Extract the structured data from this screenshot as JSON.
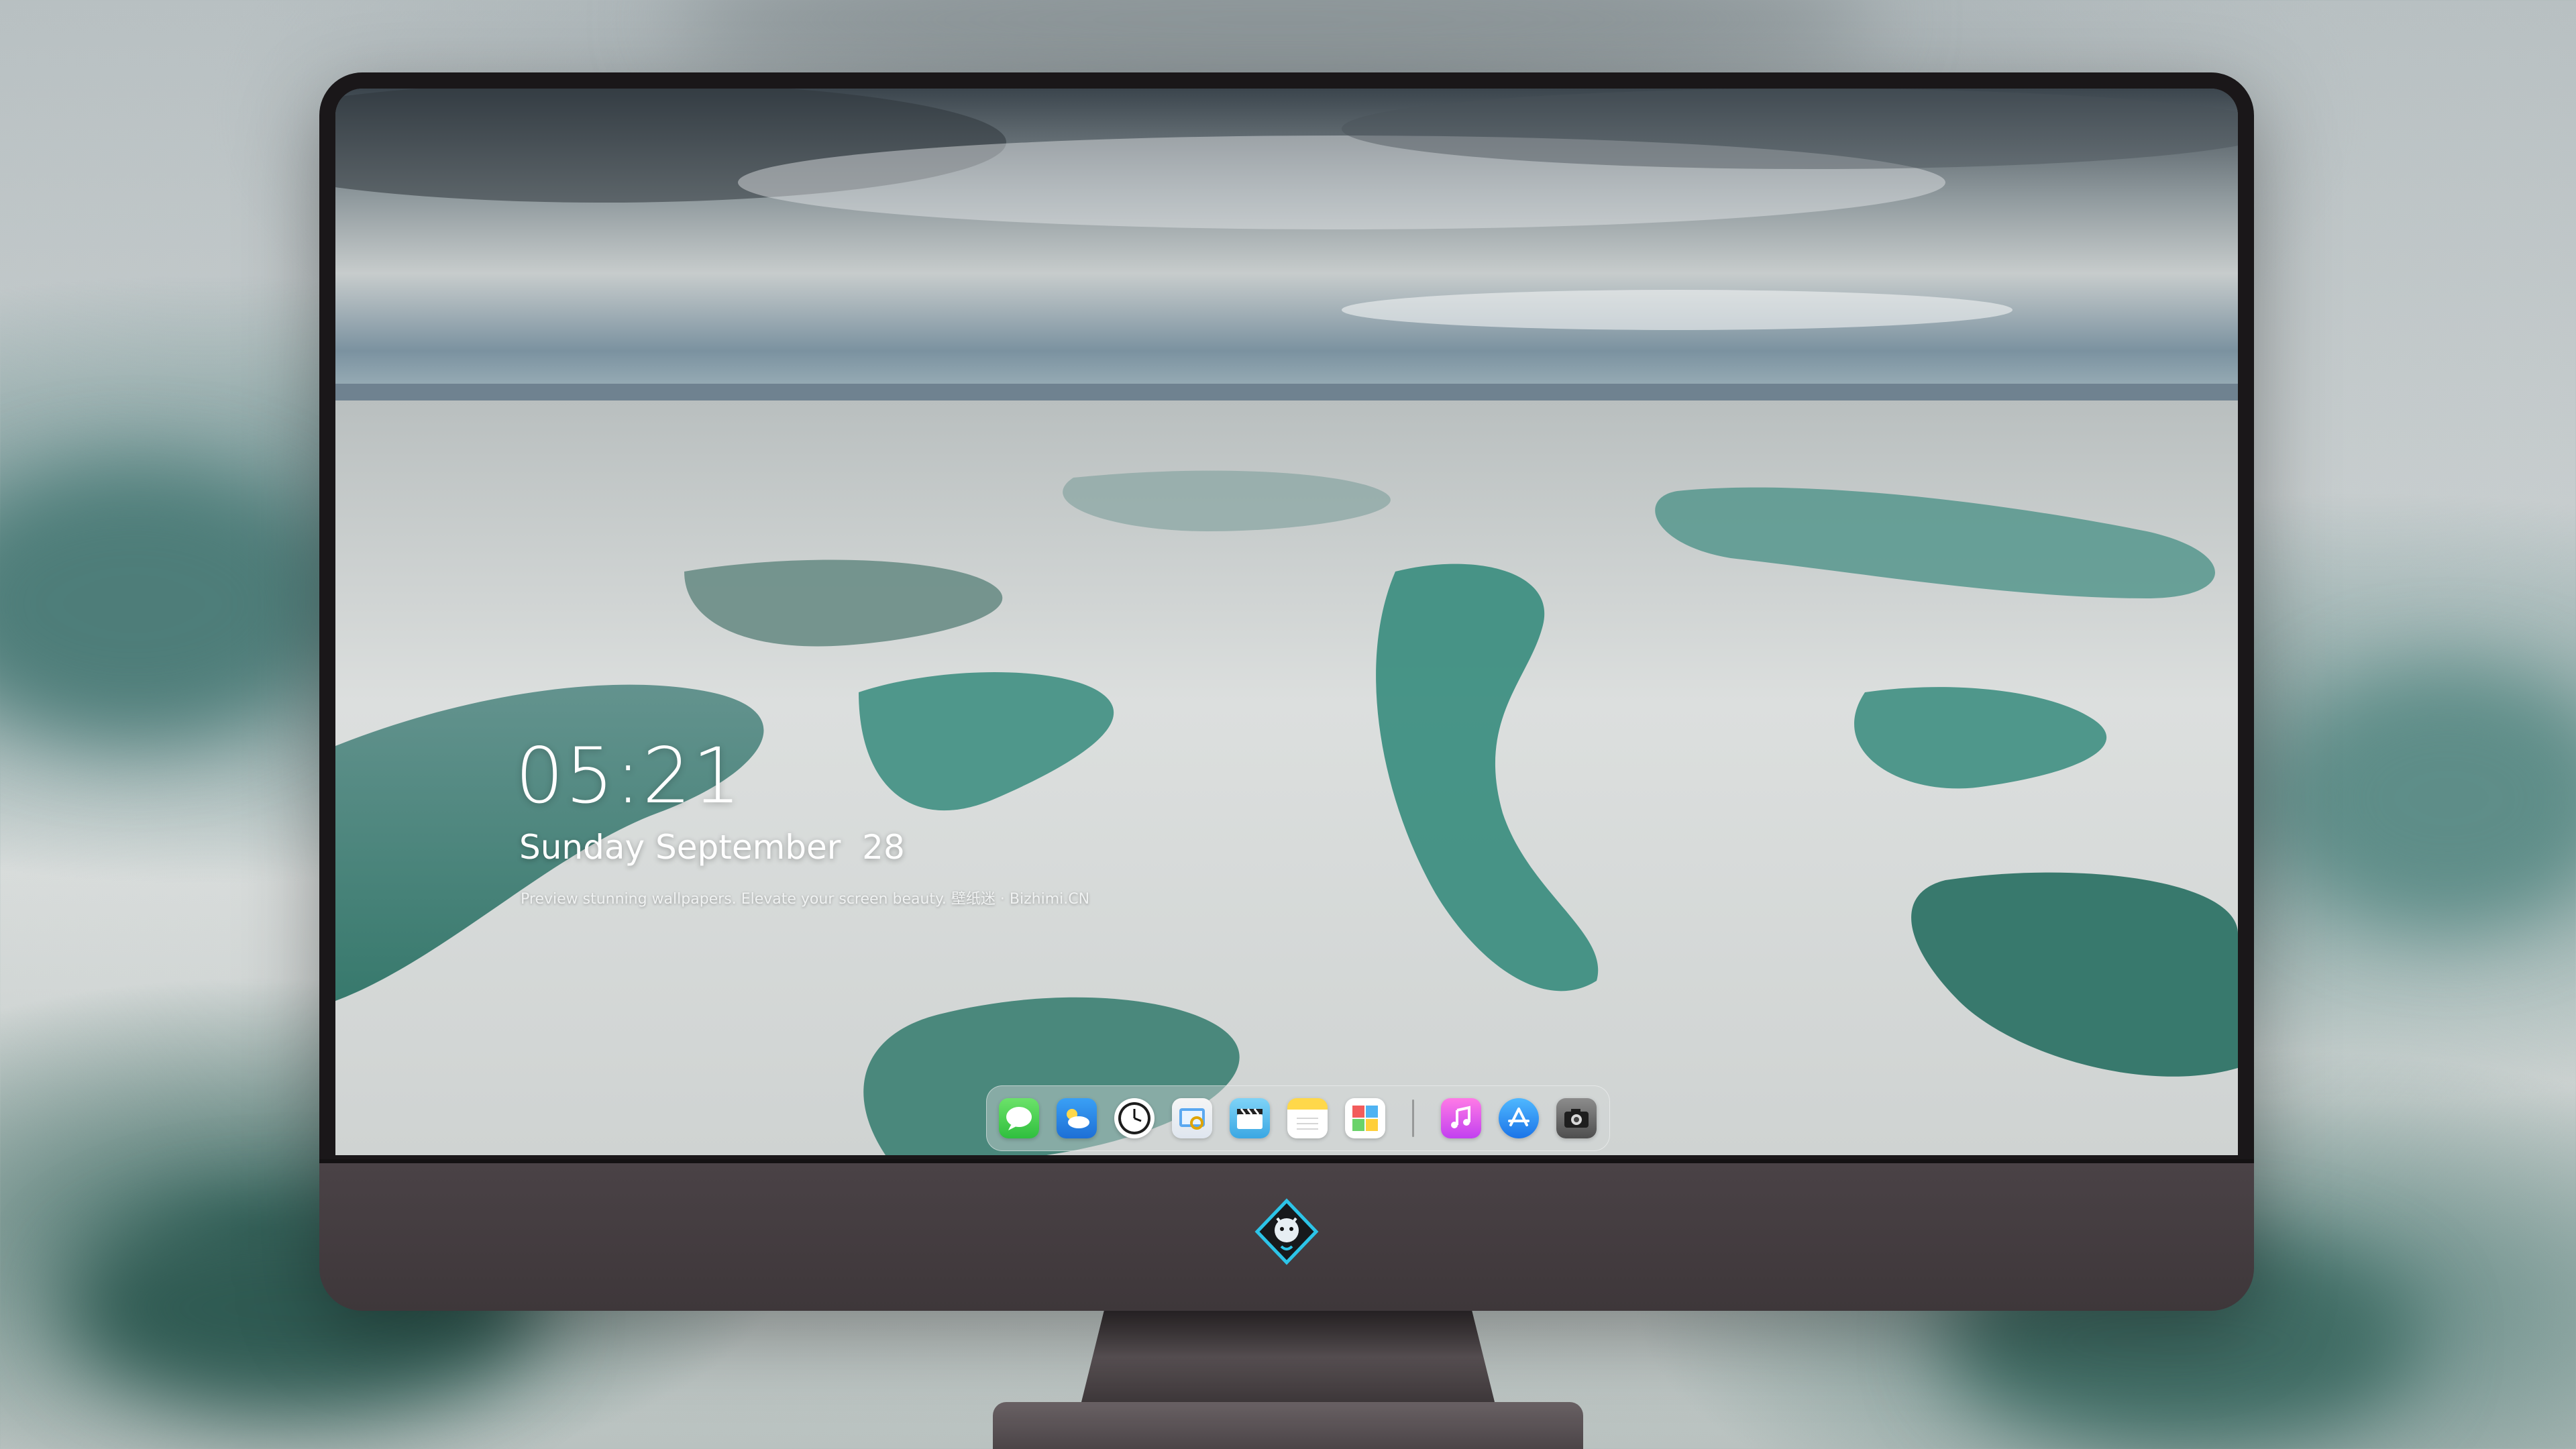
{
  "lockscreen": {
    "time": "05:21",
    "date": "Sunday September  28",
    "tagline": "Preview stunning wallpapers. Elevate your screen beauty. 壁纸迷 · Bizhimi.CN"
  },
  "dock": {
    "apps": [
      {
        "name": "messages-icon"
      },
      {
        "name": "weather-icon"
      },
      {
        "name": "clock-icon"
      },
      {
        "name": "preview-icon"
      },
      {
        "name": "video-icon"
      },
      {
        "name": "notes-icon"
      },
      {
        "name": "photo-booth-icon"
      },
      {
        "name": "music-icon"
      },
      {
        "name": "app-store-icon"
      },
      {
        "name": "camera-icon"
      }
    ]
  },
  "colors": {
    "bezel": "#1a1719",
    "chin": "#4a4246",
    "water": "#3f8f82"
  }
}
